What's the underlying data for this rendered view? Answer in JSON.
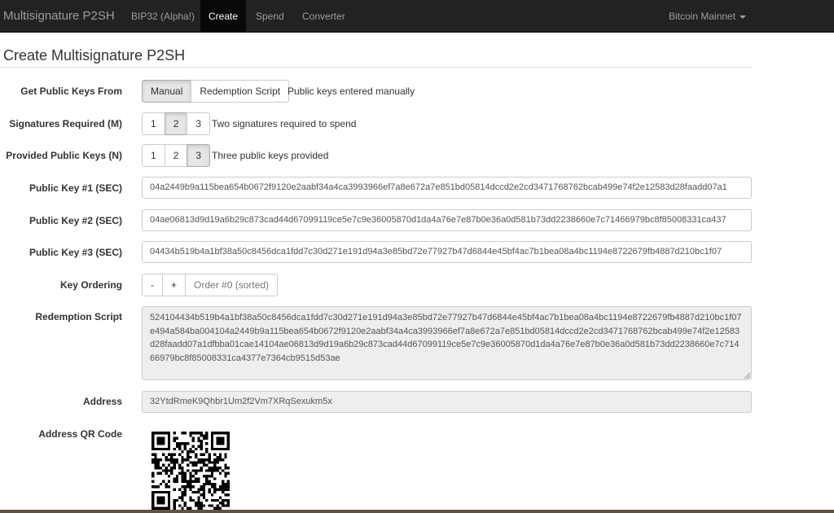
{
  "navbar": {
    "brand": "Multisignature P2SH",
    "links": [
      "BIP32 (Alpha!)",
      "Create",
      "Spend",
      "Converter"
    ],
    "active_link": "Create",
    "network": "Bitcoin Mainnet"
  },
  "page_title": "Create Multisignature P2SH",
  "get_keys": {
    "label": "Get Public Keys From",
    "options": [
      "Manual",
      "Redemption Script"
    ],
    "selected": "Manual",
    "help": "Public keys entered manually"
  },
  "signatures": {
    "label": "Signatures Required (M)",
    "options": [
      "1",
      "2",
      "3"
    ],
    "selected": "2",
    "help": "Two signatures required to spend"
  },
  "provided_keys": {
    "label": "Provided Public Keys (N)",
    "options": [
      "1",
      "2",
      "3"
    ],
    "selected": "3",
    "help": "Three public keys provided"
  },
  "pubkeys": [
    {
      "label": "Public Key #1 (SEC)",
      "value": "04a2449b9a115bea654b0672f9120e2aabf34a4ca3993966ef7a8e672a7e851bd05814dccd2e2cd3471768762bcab499e74f2e12583d28faadd07a1"
    },
    {
      "label": "Public Key #2 (SEC)",
      "value": "04ae06813d9d19a6b29c873cad44d67099119ce5e7c9e36005870d1da4a76e7e87b0e36a0d581b73dd2238660e7c71466979bc8f85008331ca437"
    },
    {
      "label": "Public Key #3 (SEC)",
      "value": "04434b519b4a1bf38a50c8456dca1fdd7c30d271e191d94a3e85bd72e77927b47d6844e45bf4ac7b1bea08a4bc1194e8722679fb4887d210bc1f07"
    }
  ],
  "key_ordering": {
    "label": "Key Ordering",
    "minus": "-",
    "plus": "+",
    "order_text": "Order #0 (sorted)"
  },
  "redemption_script": {
    "label": "Redemption Script",
    "value": "524104434b519b4a1bf38a50c8456dca1fdd7c30d271e191d94a3e85bd72e77927b47d6844e45bf4ac7b1bea08a4bc1194e8722679fb4887d210bc1f07e494a584ba004104a2449b9a115bea654b0672f9120e2aabf34a4ca3993966ef7a8e672a7e851bd05814dccd2e2cd3471768762bcab499e74f2e12583d28faadd07a1dfbba01cae14104ae06813d9d19a6b29c873cad44d67099119ce5e7c9e36005870d1da4a76e7e87b0e36a0d581b73dd2238660e7c71466979bc8f85008331ca4377e7364cb9515d53ae"
  },
  "address": {
    "label": "Address",
    "value": "32YtdRmeK9Qhbr1Um2f2Vm7XRqSexukm5x"
  },
  "qr": {
    "label": "Address QR Code",
    "icon": "qr-code-icon",
    "color": "#000000"
  }
}
